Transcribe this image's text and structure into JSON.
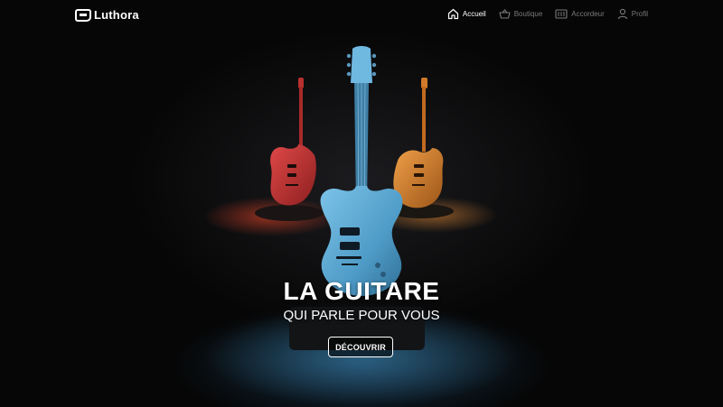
{
  "brand": {
    "name": "Luthora",
    "logo_icon": "luthora-logo-icon"
  },
  "nav": {
    "items": [
      {
        "label": "Accueil",
        "icon": "home-icon",
        "active": true
      },
      {
        "label": "Boutique",
        "icon": "basket-icon",
        "active": false
      },
      {
        "label": "Accordeur",
        "icon": "tuner-icon",
        "active": false
      },
      {
        "label": "Profil",
        "icon": "user-icon",
        "active": false
      }
    ]
  },
  "hero": {
    "title": "LA GUITARE",
    "subtitle": "QUI PARLE POUR VOUS",
    "cta_label": "DÉCOUVRIR"
  },
  "colors": {
    "background": "#060606",
    "nav_active": "#ffffff",
    "nav_inactive": "#7a7a7a",
    "guitar_left": "#d23a3a",
    "guitar_center": "#5aaedb",
    "guitar_right": "#e0852c"
  }
}
